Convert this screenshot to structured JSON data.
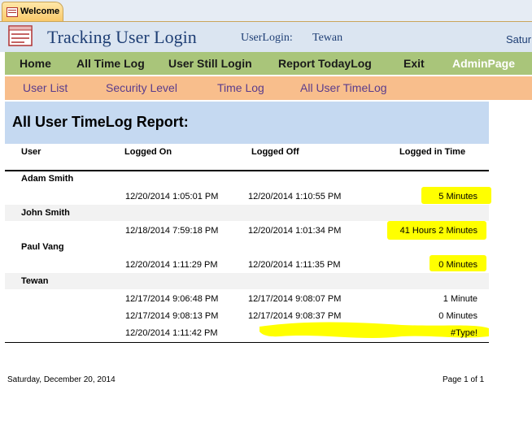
{
  "tab": {
    "label": "Welcome"
  },
  "header": {
    "title": "Tracking User Login",
    "user_login_label": "UserLogin:",
    "user_login_value": "Tewan",
    "date_partial": "Satur"
  },
  "nav_primary": [
    "Home",
    "All Time Log",
    "User Still Login",
    "Report TodayLog",
    "Exit",
    "AdminPage"
  ],
  "nav_secondary": [
    "User List",
    "Security Level",
    "Time Log",
    "All User TimeLog"
  ],
  "report": {
    "title": "All User TimeLog Report:",
    "columns": [
      "User",
      "Logged On",
      "Logged Off",
      "Logged in Time"
    ],
    "groups": [
      {
        "user": "Adam Smith",
        "rows": [
          {
            "on": "12/20/2014 1:05:01 PM",
            "off": "12/20/2014 1:10:55 PM",
            "time": "5 Minutes",
            "highlighted": true
          }
        ]
      },
      {
        "user": "John Smith",
        "rows": [
          {
            "on": "12/18/2014 7:59:18 PM",
            "off": "12/20/2014 1:01:34 PM",
            "time": "41 Hours 2 Minutes",
            "highlighted": true
          }
        ]
      },
      {
        "user": "Paul Vang",
        "rows": [
          {
            "on": "12/20/2014 1:11:29 PM",
            "off": "12/20/2014 1:11:35 PM",
            "time": "0 Minutes",
            "highlighted": true
          }
        ]
      },
      {
        "user": "Tewan",
        "rows": [
          {
            "on": "12/17/2014 9:06:48 PM",
            "off": "12/17/2014 9:08:07 PM",
            "time": "1 Minute",
            "highlighted": false
          },
          {
            "on": "12/17/2014 9:08:13 PM",
            "off": "12/17/2014 9:08:37 PM",
            "time": "0 Minutes",
            "highlighted": false
          },
          {
            "on": "12/20/2014 1:11:42 PM",
            "off": "",
            "time": "#Type!",
            "highlighted": true
          }
        ]
      }
    ],
    "footer_date": "Saturday, December 20, 2014",
    "footer_page": "Page 1 of 1"
  },
  "colors": {
    "highlight": "#ffff00",
    "nav_primary_bg": "#a9c57a",
    "nav_secondary_bg": "#f8be8c",
    "header_bg": "#dbe5f1",
    "title_color": "#1f3f75"
  }
}
